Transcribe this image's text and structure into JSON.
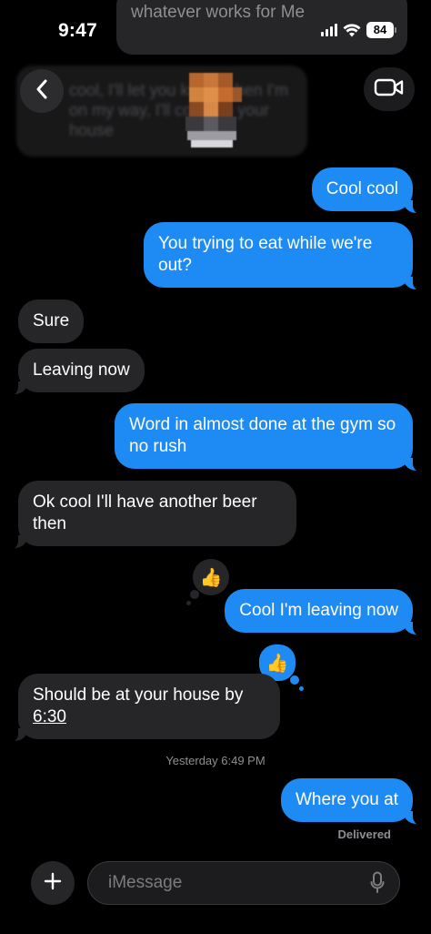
{
  "status_bar": {
    "time": "9:47",
    "battery": "84"
  },
  "header": {
    "prev_message_text": "whatever works for Me",
    "blurred_preview_text": "cool, I'll let you know when I'm on my way, I'll come to your house"
  },
  "messages": [
    {
      "direction": "outgoing",
      "text": "Cool cool"
    },
    {
      "direction": "outgoing",
      "text": "You trying to eat while we're out?"
    },
    {
      "direction": "incoming",
      "text": "Sure"
    },
    {
      "direction": "incoming",
      "text": "Leaving now"
    },
    {
      "direction": "outgoing",
      "text": "Word in almost done at the gym so no rush"
    },
    {
      "direction": "incoming",
      "text": "Ok cool I'll have another beer then"
    },
    {
      "direction": "outgoing",
      "text": "Cool I'm leaving now",
      "tapback": "👍"
    },
    {
      "direction": "incoming",
      "text_before_link": "Should be at your house by",
      "link_text": "6:30",
      "tapback": "👍"
    },
    {
      "direction": "outgoing",
      "text": "Where you at"
    }
  ],
  "timestamp": "Yesterday 6:49 PM",
  "delivery_status": "Delivered",
  "composer": {
    "placeholder": "iMessage"
  },
  "icons": {
    "back": "chevron-left-icon",
    "video": "video-camera-icon",
    "add": "plus-icon",
    "mic": "microphone-icon",
    "tapback": "thumbs-up-icon"
  },
  "colors": {
    "outgoing_bubble": "#1e8bf4",
    "incoming_bubble": "#262628",
    "background": "#000000",
    "meta_text": "#8e8e93"
  }
}
